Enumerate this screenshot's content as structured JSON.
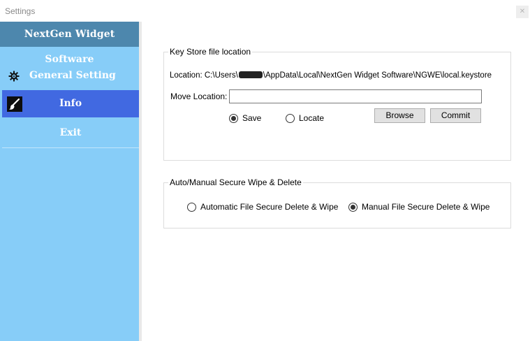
{
  "window": {
    "title": "Settings",
    "close_symbol": "✕"
  },
  "sidebar": {
    "brand": "NextGen Widget Software",
    "items": [
      {
        "label": "General Setting",
        "icon": "gear-icon"
      },
      {
        "label": "Info",
        "icon": "brush-icon",
        "selected": true
      },
      {
        "label": "Exit"
      }
    ],
    "colors": {
      "background": "#87cdf8",
      "brand_bg": "#4d87ad",
      "selected_bg": "#4169e1"
    }
  },
  "keystore": {
    "legend": "Key Store file location",
    "location_prefix": "Location: C:\\Users\\",
    "location_suffix": "\\AppData\\Local\\NextGen Widget Software\\NGWE\\local.keystore",
    "move_label": "Move Location:",
    "move_value": "",
    "radio_save": "Save",
    "radio_locate": "Locate",
    "selected_option": "Save",
    "browse_label": "Browse",
    "commit_label": "Commit"
  },
  "wipe": {
    "legend": "Auto/Manual Secure  Wipe & Delete",
    "option_auto": "Automatic File Secure Delete & Wipe",
    "option_manual": "Manual File Secure Delete & Wipe",
    "selected_option": "Manual File Secure Delete & Wipe"
  }
}
